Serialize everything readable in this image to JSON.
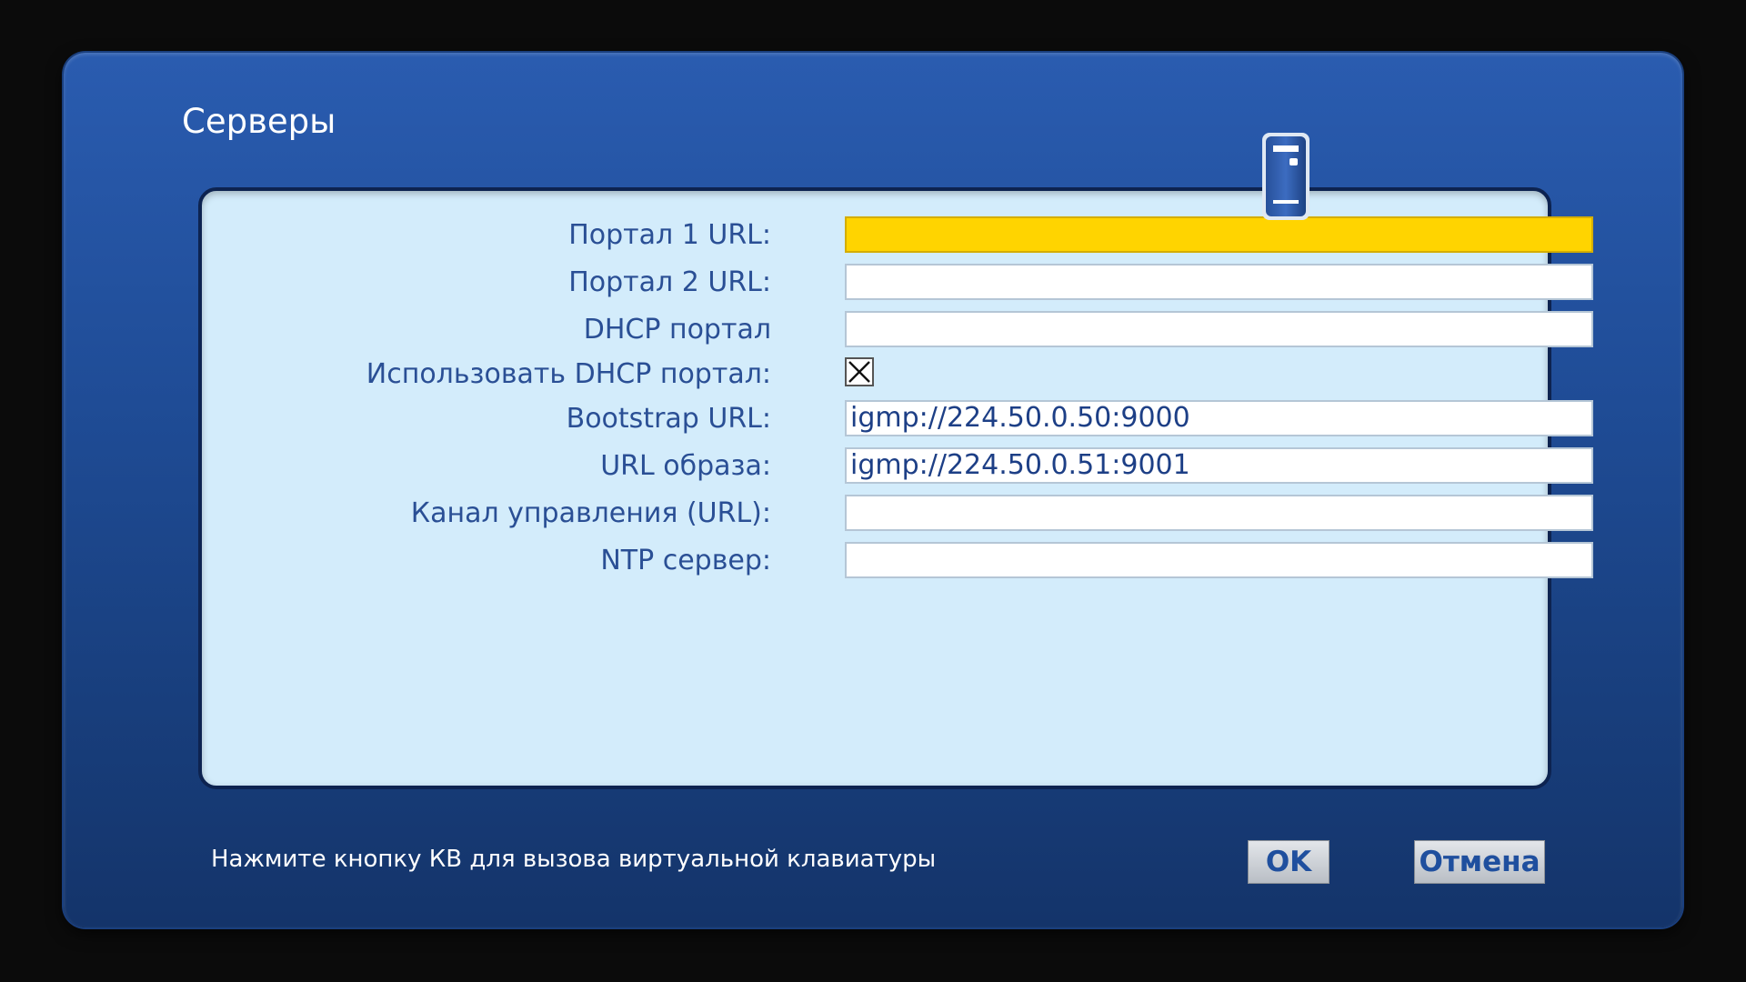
{
  "dialog": {
    "title": "Серверы",
    "hint": "Нажмите кнопку КВ для вызова виртуальной клавиатуры",
    "ok_label": "OK",
    "cancel_label": "Отмена"
  },
  "form": {
    "rows": [
      {
        "label": "Портал 1 URL:",
        "value": "",
        "type": "text",
        "active": true
      },
      {
        "label": "Портал 2 URL:",
        "value": "",
        "type": "text"
      },
      {
        "label": "DHCP портал",
        "value": "",
        "type": "text"
      },
      {
        "label": "Использовать DHCP портал:",
        "checked": true,
        "type": "checkbox"
      },
      {
        "label": "Bootstrap URL:",
        "value": "igmp://224.50.0.50:9000",
        "type": "text"
      },
      {
        "label": "URL образа:",
        "value": "igmp://224.50.0.51:9001",
        "type": "text"
      },
      {
        "label": "Канал управления (URL):",
        "value": "",
        "type": "text"
      },
      {
        "label": "NTP сервер:",
        "value": "",
        "type": "text"
      }
    ]
  },
  "icons": {
    "header": "server-icon",
    "checkbox_mark": "x-mark-icon"
  },
  "colors": {
    "active_field": "#ffd400",
    "label_text": "#2a4f95",
    "panel_bg": "#d3ecfb",
    "dialog_bg": "#1f4c96"
  }
}
